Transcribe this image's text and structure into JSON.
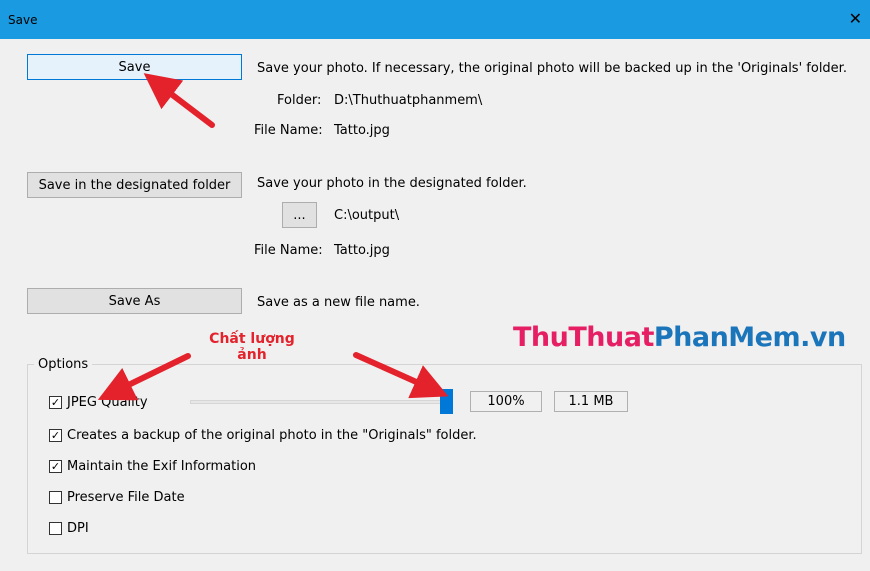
{
  "window": {
    "title": "Save"
  },
  "save": {
    "button": "Save",
    "description": "Save your photo. If necessary, the original photo will be backed up in the 'Originals' folder.",
    "folder_label": "Folder:",
    "folder_value": "D:\\Thuthuatphanmem\\",
    "file_label": "File Name:",
    "file_value": "Tatto.jpg"
  },
  "designated": {
    "button": "Save in the designated folder",
    "description": "Save your photo in the designated folder.",
    "browse": "...",
    "folder_value": "C:\\output\\",
    "file_label": "File Name:",
    "file_value": "Tatto.jpg"
  },
  "saveas": {
    "button": "Save As",
    "description": "Save as a new file name."
  },
  "options": {
    "label": "Options",
    "jpeg_quality": {
      "label": "JPEG Quality",
      "checked": true
    },
    "quality_value": 100,
    "quality_percent": "100%",
    "file_size": "1.1 MB",
    "backup": {
      "label": "Creates a backup of the original photo in the \"Originals\" folder.",
      "checked": true
    },
    "exif": {
      "label": "Maintain the Exif Information",
      "checked": true
    },
    "file_date": {
      "label": "Preserve File Date",
      "checked": false
    },
    "dpi": {
      "label": "DPI",
      "checked": false
    }
  },
  "annotation": {
    "line1": "Chất lượng",
    "line2": "ảnh"
  },
  "watermark": {
    "part1": "ThuThuat",
    "part2": "PhanMem.vn"
  },
  "colors": {
    "titlebar": "#1a9ae0",
    "slider_thumb": "#0078d7",
    "annotation": "#e4222c"
  }
}
